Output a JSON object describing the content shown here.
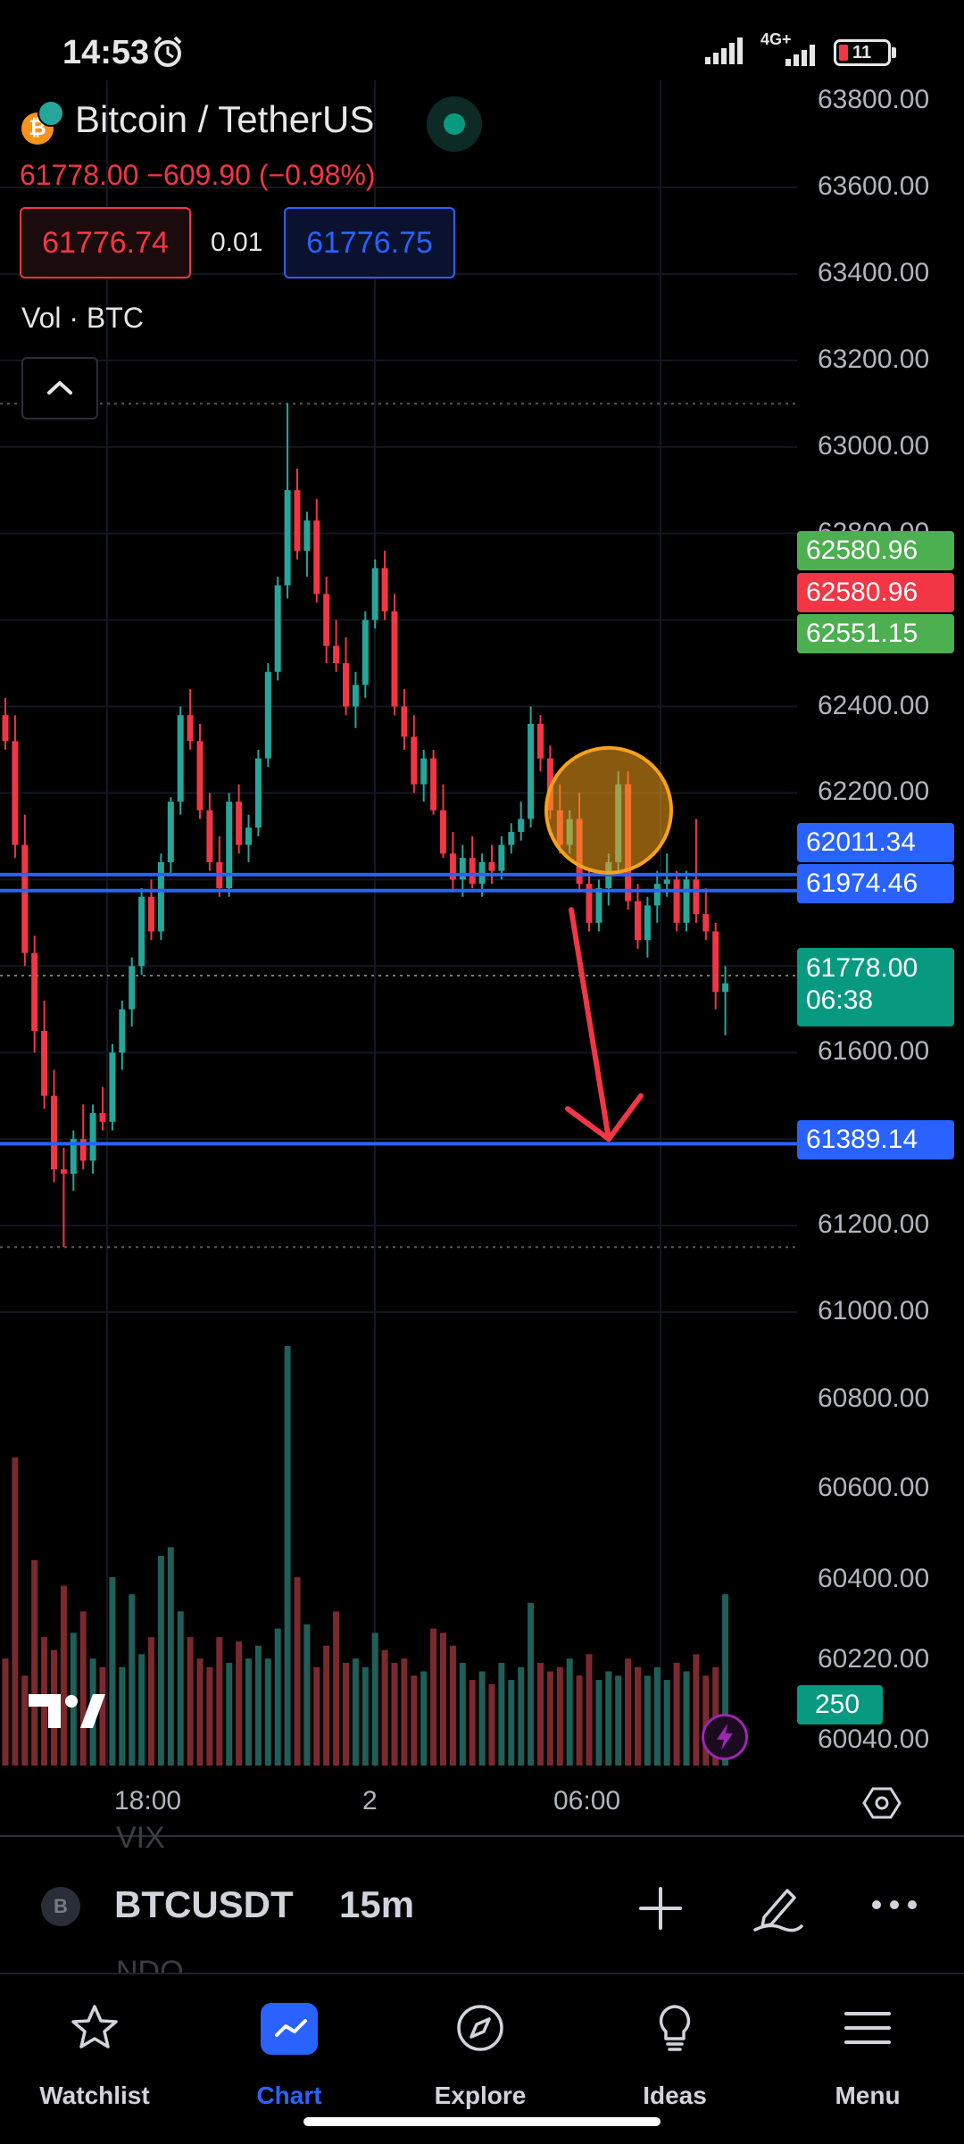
{
  "status_bar": {
    "time": "14:53",
    "network": "4G+",
    "battery": "11"
  },
  "header": {
    "symbol_title": "Bitcoin / TetherUS",
    "coin_glyph": "₿",
    "last_price_line": "61778.00  −609.90 (−0.98%)",
    "bid": "61776.74",
    "spread": "0.01",
    "ask": "61776.75",
    "volume_label": "Vol · BTC"
  },
  "colors": {
    "up": "#26a69a",
    "down": "#f23645",
    "blue_line": "#2962ff",
    "current_price": "#089981",
    "annotation_circle": "#f7a21b",
    "annotation_arrow": "#f23645"
  },
  "chart_data": {
    "type": "candlestick",
    "symbol": "BTCUSDT",
    "interval": "15m",
    "price_axis_labels": [
      "63800.00",
      "63600.00",
      "63400.00",
      "63200.00",
      "63000.00",
      "62800.00",
      "62400.00",
      "62200.00",
      "61600.00",
      "61200.00",
      "61000.00"
    ],
    "volume_axis_labels": [
      "60800.00",
      "60600.00",
      "60400.00",
      "60220.00",
      "60040.00"
    ],
    "time_labels": [
      "18:00",
      "2",
      "06:00"
    ],
    "horizontal_lines": [
      62011.34,
      61974.46,
      61389.14
    ],
    "price_tags": [
      {
        "value": "62580.96",
        "color": "#4caf50"
      },
      {
        "value": "62580.96",
        "color": "#f23645"
      },
      {
        "value": "62551.15",
        "color": "#4caf50"
      },
      {
        "value": "62011.34",
        "color": "#2962ff"
      },
      {
        "value": "61974.46",
        "color": "#2962ff"
      },
      {
        "value": "61389.14",
        "color": "#2962ff"
      }
    ],
    "current_price": {
      "value": "61778.00",
      "countdown": "06:38"
    },
    "volume_tag": "250",
    "session_high": 63100,
    "session_low": 61150,
    "candles": [
      [
        62380,
        62420,
        62300,
        62320
      ],
      [
        62320,
        62380,
        62050,
        62080
      ],
      [
        62080,
        62150,
        61800,
        61830
      ],
      [
        61830,
        61870,
        61600,
        61650
      ],
      [
        61650,
        61720,
        61470,
        61500
      ],
      [
        61500,
        61560,
        61300,
        61330
      ],
      [
        61330,
        61380,
        61150,
        61320
      ],
      [
        61320,
        61420,
        61280,
        61400
      ],
      [
        61400,
        61480,
        61330,
        61350
      ],
      [
        61350,
        61480,
        61320,
        61460
      ],
      [
        61460,
        61520,
        61420,
        61440
      ],
      [
        61440,
        61620,
        61420,
        61600
      ],
      [
        61600,
        61720,
        61560,
        61700
      ],
      [
        61700,
        61820,
        61660,
        61800
      ],
      [
        61800,
        61980,
        61780,
        61960
      ],
      [
        61960,
        62000,
        61860,
        61880
      ],
      [
        61880,
        62060,
        61860,
        62040
      ],
      [
        62040,
        62190,
        62010,
        62180
      ],
      [
        62180,
        62400,
        62150,
        62380
      ],
      [
        62380,
        62440,
        62300,
        62320
      ],
      [
        62320,
        62360,
        62140,
        62160
      ],
      [
        62160,
        62200,
        62020,
        62040
      ],
      [
        62040,
        62100,
        61960,
        61980
      ],
      [
        61980,
        62200,
        61960,
        62180
      ],
      [
        62180,
        62220,
        62060,
        62080
      ],
      [
        62080,
        62150,
        62040,
        62120
      ],
      [
        62120,
        62300,
        62100,
        62280
      ],
      [
        62280,
        62500,
        62260,
        62480
      ],
      [
        62480,
        62700,
        62460,
        62680
      ],
      [
        62680,
        63100,
        62650,
        62900
      ],
      [
        62900,
        62950,
        62740,
        62760
      ],
      [
        62760,
        62850,
        62700,
        62830
      ],
      [
        62830,
        62880,
        62640,
        62660
      ],
      [
        62660,
        62700,
        62500,
        62540
      ],
      [
        62540,
        62600,
        62480,
        62500
      ],
      [
        62500,
        62560,
        62380,
        62400
      ],
      [
        62400,
        62480,
        62350,
        62450
      ],
      [
        62450,
        62620,
        62420,
        62600
      ],
      [
        62600,
        62740,
        62580,
        62720
      ],
      [
        62720,
        62760,
        62600,
        62620
      ],
      [
        62620,
        62660,
        62380,
        62400
      ],
      [
        62400,
        62440,
        62300,
        62330
      ],
      [
        62330,
        62380,
        62200,
        62220
      ],
      [
        62220,
        62300,
        62180,
        62280
      ],
      [
        62280,
        62300,
        62150,
        62160
      ],
      [
        62160,
        62220,
        62050,
        62060
      ],
      [
        62060,
        62110,
        61970,
        62000
      ],
      [
        62000,
        62080,
        61960,
        62050
      ],
      [
        62050,
        62100,
        61980,
        61990
      ],
      [
        61990,
        62060,
        61960,
        62040
      ],
      [
        62040,
        62080,
        61990,
        62020
      ],
      [
        62020,
        62100,
        62000,
        62080
      ],
      [
        62080,
        62130,
        62060,
        62110
      ],
      [
        62110,
        62180,
        62090,
        62140
      ],
      [
        62140,
        62400,
        62120,
        62360
      ],
      [
        62360,
        62380,
        62250,
        62280
      ],
      [
        62280,
        62310,
        62140,
        62160
      ],
      [
        62160,
        62220,
        62060,
        62080
      ],
      [
        62080,
        62160,
        62060,
        62140
      ],
      [
        62140,
        62200,
        61970,
        61990
      ],
      [
        61990,
        62020,
        61880,
        61900
      ],
      [
        61900,
        62000,
        61880,
        61980
      ],
      [
        61980,
        62060,
        61940,
        62040
      ],
      [
        62040,
        62250,
        62020,
        62220
      ],
      [
        62220,
        62250,
        61930,
        61950
      ],
      [
        61950,
        61990,
        61840,
        61860
      ],
      [
        61860,
        61960,
        61820,
        61940
      ],
      [
        61940,
        62020,
        61900,
        61990
      ],
      [
        61990,
        62060,
        61960,
        62000
      ],
      [
        62000,
        62020,
        61880,
        61900
      ],
      [
        61900,
        62020,
        61880,
        62000
      ],
      [
        62000,
        62140,
        61900,
        61920
      ],
      [
        61920,
        61980,
        61860,
        61880
      ],
      [
        61880,
        61900,
        61700,
        61740
      ],
      [
        61740,
        61800,
        61640,
        61760
      ]
    ],
    "volumes": [
      250,
      720,
      210,
      480,
      300,
      270,
      420,
      310,
      360,
      250,
      230,
      440,
      230,
      400,
      260,
      300,
      490,
      510,
      360,
      300,
      250,
      230,
      300,
      240,
      290,
      250,
      280,
      250,
      320,
      980,
      440,
      330,
      230,
      280,
      360,
      240,
      250,
      230,
      310,
      270,
      240,
      250,
      210,
      220,
      320,
      310,
      280,
      240,
      200,
      220,
      190,
      240,
      200,
      230,
      380,
      240,
      220,
      230,
      250,
      210,
      260,
      200,
      220,
      210,
      250,
      230,
      210,
      230,
      200,
      240,
      220,
      260,
      210,
      230,
      400
    ]
  },
  "toolbar": {
    "symbol_badge": "B",
    "symbol": "BTCUSDT",
    "interval": "15m",
    "ghost_above": "VIX",
    "ghost_below": "NDQ"
  },
  "nav": {
    "items": [
      {
        "label": "Watchlist",
        "icon": "star-icon"
      },
      {
        "label": "Chart",
        "icon": "chart-icon"
      },
      {
        "label": "Explore",
        "icon": "compass-icon"
      },
      {
        "label": "Ideas",
        "icon": "lightbulb-icon"
      },
      {
        "label": "Menu",
        "icon": "hamburger-icon"
      }
    ],
    "active": "Chart"
  }
}
